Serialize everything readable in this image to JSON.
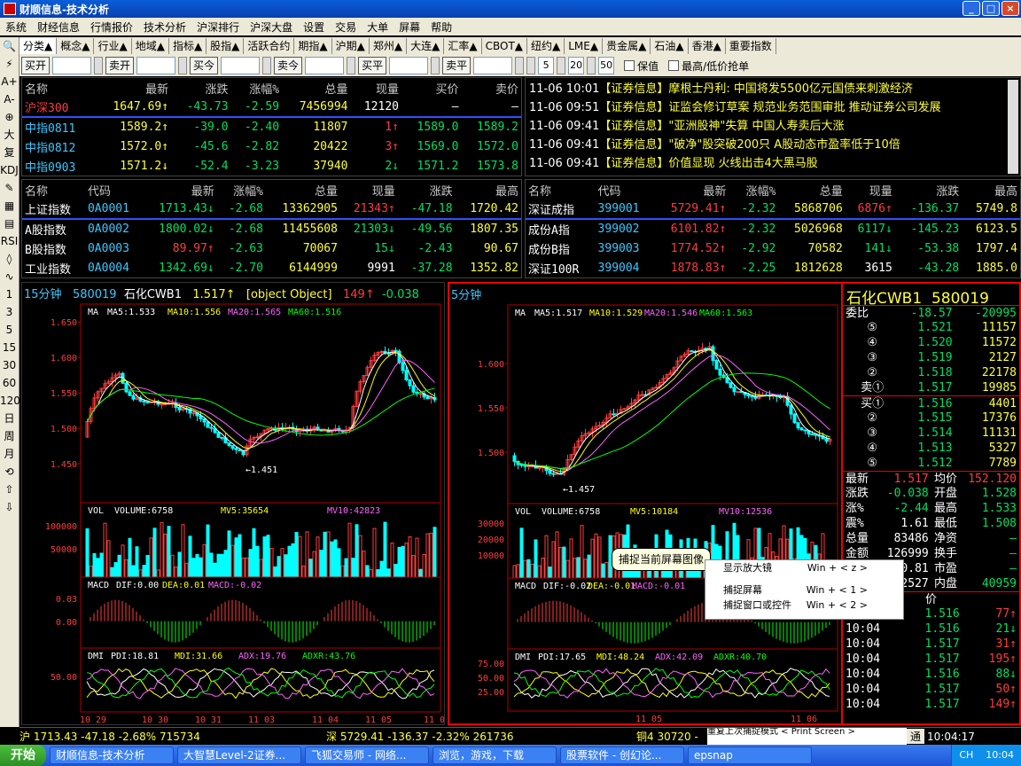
{
  "window": {
    "title": "财顺信息-技术分析",
    "min": "_",
    "max": "□",
    "close": "×"
  },
  "menu": [
    "系统",
    "财经信息",
    "行情报价",
    "技术分析",
    "沪深排行",
    "沪深大盘",
    "设置",
    "交易",
    "大单",
    "屏幕",
    "帮助"
  ],
  "tabs": [
    "分类▲",
    "概念▲",
    "行业▲",
    "地域▲",
    "指标▲",
    "股指▲",
    "活跃合约",
    "期指▲",
    "沪期▲",
    "郑州▲",
    "大连▲",
    "汇率▲",
    "CBOT▲",
    "纽约▲",
    "LME▲",
    "贵金属▲",
    "石油▲",
    "香港▲",
    "重要指数"
  ],
  "orders": {
    "buy_open": "买开",
    "sell_open": "卖开",
    "buy_today": "买今",
    "sell_today": "卖今",
    "buy_flat": "买平",
    "sell_flat": "卖平",
    "n1": "5",
    "n2": "20",
    "n3": "50",
    "keep_price": "保值",
    "high_low": "最高/低价抢单"
  },
  "toolbar": [
    "🔍",
    "⚡",
    "A+",
    "A-",
    "⊕",
    "大",
    "复",
    "KDJ",
    "✎",
    "▦",
    "▤",
    "RSI",
    "◊",
    "∿",
    "1",
    "3",
    "5",
    "15",
    "30",
    "60",
    "120",
    "日",
    "周",
    "月",
    "⟲",
    "⇧",
    "⇩"
  ],
  "futures": {
    "headers": [
      "名称",
      "最新",
      "涨跌",
      "涨幅%",
      "总量",
      "现量",
      "买价",
      "卖价"
    ],
    "rows": [
      {
        "name": "沪深300",
        "last": "1647.69↑",
        "chg": "-43.73",
        "pct": "-2.59",
        "vol": "7456994",
        "cur": "12120",
        "bid": "—",
        "ask": "—"
      },
      {
        "name": "中指0811",
        "last": "1589.2↑",
        "chg": "-39.0",
        "pct": "-2.40",
        "vol": "11807",
        "cur": "1↑",
        "bid": "1589.0",
        "ask": "1589.2"
      },
      {
        "name": "中指0812",
        "last": "1572.0↑",
        "chg": "-45.6",
        "pct": "-2.82",
        "vol": "20422",
        "cur": "3↑",
        "bid": "1569.0",
        "ask": "1572.0"
      },
      {
        "name": "中指0903",
        "last": "1571.2↓",
        "chg": "-52.4",
        "pct": "-3.23",
        "vol": "37940",
        "cur": "2↓",
        "bid": "1571.2",
        "ask": "1573.8"
      }
    ]
  },
  "news": [
    {
      "time": "11-06 10:01",
      "tag": "【证券信息】",
      "text": "摩根士丹利: 中国将发5500亿元国债来刺激经济"
    },
    {
      "time": "11-06 09:51",
      "tag": "【证券信息】",
      "text": "证监会修订草案 规范业务范围审批 推动证券公司发展"
    },
    {
      "time": "11-06 09:41",
      "tag": "【证券信息】",
      "text": "\"亚洲股神\"失算 中国人寿卖后大涨"
    },
    {
      "time": "11-06 09:41",
      "tag": "【证券信息】",
      "text": "\"破净\"股突破200只 A股动态市盈率低于10倍"
    },
    {
      "time": "11-06 09:41",
      "tag": "【证券信息】",
      "text": "价值显现 火线出击4大黑马股"
    }
  ],
  "sh_index": {
    "headers": [
      "名称",
      "代码",
      "最新",
      "涨幅%",
      "总量",
      "现量",
      "涨跌",
      "最高"
    ],
    "rows": [
      {
        "name": "上证指数",
        "code": "0A0001",
        "last": "1713.43↓",
        "pct": "-2.68",
        "vol": "13362905",
        "cur": "21343↑",
        "chg": "-47.18",
        "high": "1720.42"
      },
      {
        "name": "A股指数",
        "code": "0A0002",
        "last": "1800.02↓",
        "pct": "-2.68",
        "vol": "11455608",
        "cur": "21303↓",
        "chg": "-49.56",
        "high": "1807.35"
      },
      {
        "name": "B股指数",
        "code": "0A0003",
        "last": "89.97↑",
        "pct": "-2.63",
        "vol": "70067",
        "cur": "15↓",
        "chg": "-2.43",
        "high": "90.67"
      },
      {
        "name": "工业指数",
        "code": "0A0004",
        "last": "1342.69↓",
        "pct": "-2.70",
        "vol": "6144999",
        "cur": "9991",
        "chg": "-37.28",
        "high": "1352.82"
      }
    ]
  },
  "sz_index": {
    "headers": [
      "名称",
      "代码",
      "最新",
      "涨幅%",
      "总量",
      "现量",
      "涨跌",
      "最高"
    ],
    "rows": [
      {
        "name": "深证成指",
        "code": "399001",
        "last": "5729.41↑",
        "pct": "-2.32",
        "vol": "5868706",
        "cur": "6876↑",
        "chg": "-136.37",
        "high": "5749.8"
      },
      {
        "name": "成份A指",
        "code": "399002",
        "last": "6101.82↑",
        "pct": "-2.32",
        "vol": "5026968",
        "cur": "6117↓",
        "chg": "-145.23",
        "high": "6123.5"
      },
      {
        "name": "成份B指",
        "code": "399003",
        "last": "1774.52↑",
        "pct": "-2.92",
        "vol": "70582",
        "cur": "141↓",
        "chg": "-53.38",
        "high": "1797.4"
      },
      {
        "name": "深证100R",
        "code": "399004",
        "last": "1878.83↑",
        "pct": "-2.25",
        "vol": "1812628",
        "cur": "3615",
        "chg": "-43.28",
        "high": "1885.0"
      }
    ]
  },
  "chart15": {
    "period": "15分钟",
    "code": "580019",
    "name": "石化CWB1",
    "price": "1.517↑",
    "vol": {
      "label": "VOL",
      "v": "VOLUME:6758",
      "mv5": "MV5:35654",
      "mv10": "MV10:42823",
      "ticks": [
        "100000",
        "50000"
      ]
    },
    "cur": "149↑",
    "chg": "-0.038",
    "ma": {
      "label": "MA",
      "ma5": "MA5:1.533",
      "ma10": "MA10:1.556",
      "ma20": "MA20:1.565",
      "ma60": "MA60:1.516"
    },
    "price_ticks": [
      "1.650",
      "1.600",
      "1.550",
      "1.500",
      "1.450"
    ],
    "low_label": "1.451",
    "macd": {
      "label": "MACD",
      "dif": "DIF:0.00",
      "dea": "DEA:0.01",
      "macd": "MACD:-0.02",
      "ticks": [
        "0.03",
        "0.00"
      ]
    },
    "dmi": {
      "label": "DMI",
      "pdi": "PDI:18.81",
      "mdi": "MDI:31.66",
      "adx": "ADX:19.76",
      "adxr": "ADXR:43.76",
      "ticks": [
        "50.00"
      ]
    },
    "dates": [
      "10 29",
      "10 30",
      "10 31",
      "11 03",
      "11 04",
      "11 05",
      "11 06"
    ]
  },
  "chart5": {
    "period": "5分钟",
    "ma": {
      "label": "MA",
      "ma5": "MA5:1.517",
      "ma10": "MA10:1.529",
      "ma20": "MA20:1.546",
      "ma60": "MA60:1.563"
    },
    "price_ticks": [
      "1.600",
      "1.550",
      "1.500"
    ],
    "low_label": "1.457",
    "vol": {
      "label": "VOL",
      "v": "VOLUME:6758",
      "mv5": "MV5:10184",
      "mv10": "MV10:12536",
      "ticks": [
        "30000",
        "20000",
        "10000"
      ]
    },
    "macd": {
      "label": "MACD",
      "dif": "DIF:-0.02",
      "dea": "DEA:-0.01",
      "macd": "MACD:-0.01"
    },
    "dmi": {
      "label": "DMI",
      "pdi": "PDI:17.65",
      "mdi": "MDI:48.24",
      "adx": "ADX:42.09",
      "adxr": "ADXR:40.70",
      "ticks": [
        "75.00",
        "50.00",
        "25.00"
      ]
    },
    "dates": [
      "11 05",
      "11 06"
    ]
  },
  "quote": {
    "title": "石化CWB1",
    "code": "580019",
    "wb_label": "委比",
    "wb": "-18.57",
    "wc": "-20995",
    "sells": [
      {
        "l": "⑤",
        "p": "1.521",
        "v": "11157"
      },
      {
        "l": "④",
        "p": "1.520",
        "v": "11572"
      },
      {
        "l": "③",
        "p": "1.519",
        "v": "2127"
      },
      {
        "l": "②",
        "p": "1.518",
        "v": "22178"
      },
      {
        "l": "卖①",
        "p": "1.517",
        "v": "19985"
      }
    ],
    "buys": [
      {
        "l": "买①",
        "p": "1.516",
        "v": "4401"
      },
      {
        "l": "②",
        "p": "1.515",
        "v": "17376"
      },
      {
        "l": "③",
        "p": "1.514",
        "v": "11131"
      },
      {
        "l": "④",
        "p": "1.513",
        "v": "5327"
      },
      {
        "l": "⑤",
        "p": "1.512",
        "v": "7789"
      }
    ],
    "stats": [
      {
        "k1": "最新",
        "v1": "1.517",
        "k2": "均价",
        "v2": "152.120"
      },
      {
        "k1": "涨跌",
        "v1": "-0.038",
        "k2": "开盘",
        "v2": "1.528"
      },
      {
        "k1": "涨%",
        "v1": "-2.44",
        "k2": "最高",
        "v2": "1.533"
      },
      {
        "k1": "震%",
        "v1": "1.61",
        "k2": "最低",
        "v2": "1.508"
      },
      {
        "k1": "总量",
        "v1": "83486",
        "k2": "净资",
        "v2": "—"
      },
      {
        "k1": "金额",
        "v1": "126999",
        "k2": "换手",
        "v2": "—"
      },
      {
        "k1": "",
        "v1": "0.81",
        "k2": "市盈",
        "v2": "—"
      },
      {
        "k1": "",
        "v1": "2527",
        "k2": "内盘",
        "v2": "40959"
      }
    ],
    "tick_header": "价",
    "ticks": [
      {
        "t": "10:04",
        "p": "1.516",
        "v": "77↑"
      },
      {
        "t": "10:04",
        "p": "1.516",
        "v": "21↓"
      },
      {
        "t": "10:04",
        "p": "1.517",
        "v": "31↑"
      },
      {
        "t": "10:04",
        "p": "1.517",
        "v": "195↑"
      },
      {
        "t": "10:04",
        "p": "1.516",
        "v": "88↓"
      },
      {
        "t": "10:04",
        "p": "1.517",
        "v": "50↑"
      },
      {
        "t": "10:04",
        "p": "1.517",
        "v": "149↑"
      }
    ]
  },
  "tooltip": "捕捉当前屏幕图像",
  "context_menu": [
    {
      "label": "显示放大镜",
      "key": "Win + < z >"
    },
    {
      "label": "捕捉屏幕",
      "key": "Win + < 1 >"
    },
    {
      "label": "捕捉窗口或控件",
      "key": "Win + < 2 >"
    }
  ],
  "status": {
    "sh": "沪 1713.43 -47.18 -2.68% 715734",
    "sz": "深 5729.41 -136.37 -2.32% 261736",
    "cu": "铜4 30720 -",
    "menu_tail": "重复上次捕捉模式  < Print Screen >",
    "tong": "通",
    "time": "10:04:17"
  },
  "taskbar": {
    "start": "开始",
    "items": [
      "财顺信息-技术分析",
      "大智慧Level-2证券...",
      "飞狐交易师 - 网络...",
      "浏览，游戏，下载",
      "股票软件 - 创幻论...",
      "epsnap"
    ],
    "tray": "CH",
    "clock": "10:04"
  }
}
